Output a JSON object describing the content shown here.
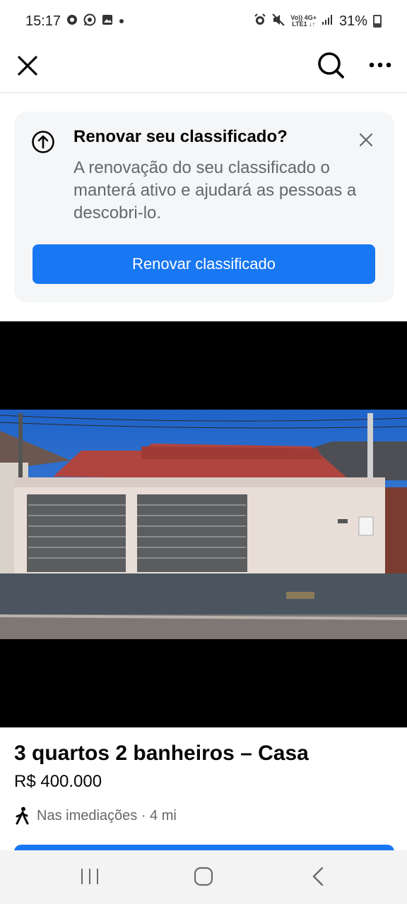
{
  "status_bar": {
    "time": "15:17",
    "left_icons": [
      "chrome-icon",
      "whatsapp-icon",
      "gallery-icon",
      "notification-dot"
    ],
    "right_icons": [
      "alarm-icon",
      "mute-icon",
      "volte-lte-icon",
      "signal-icon"
    ],
    "network_top": "Vo)) 4G+",
    "network_bottom": "LTE1 ↓↑",
    "battery": "31%"
  },
  "nav": {
    "close_icon": "close-icon",
    "search_icon": "search-icon",
    "more_icon": "more-icon"
  },
  "renew_card": {
    "icon": "arrow-up-circle-icon",
    "title": "Renovar seu classificado?",
    "body": "A renovação do seu classificado o manterá ativo e ajudará as pessoas a descobri-lo.",
    "button_label": "Renovar classificado",
    "dismiss_icon": "close-icon"
  },
  "listing": {
    "title": "3 quartos 2 banheiros – Casa",
    "price": "R$ 400.000",
    "location": "Nas imediações · 4 mi",
    "location_icon": "walking-icon"
  },
  "colors": {
    "accent": "#1877f2",
    "secondary_text": "#65676b",
    "card_background": "#f5f6f8"
  }
}
